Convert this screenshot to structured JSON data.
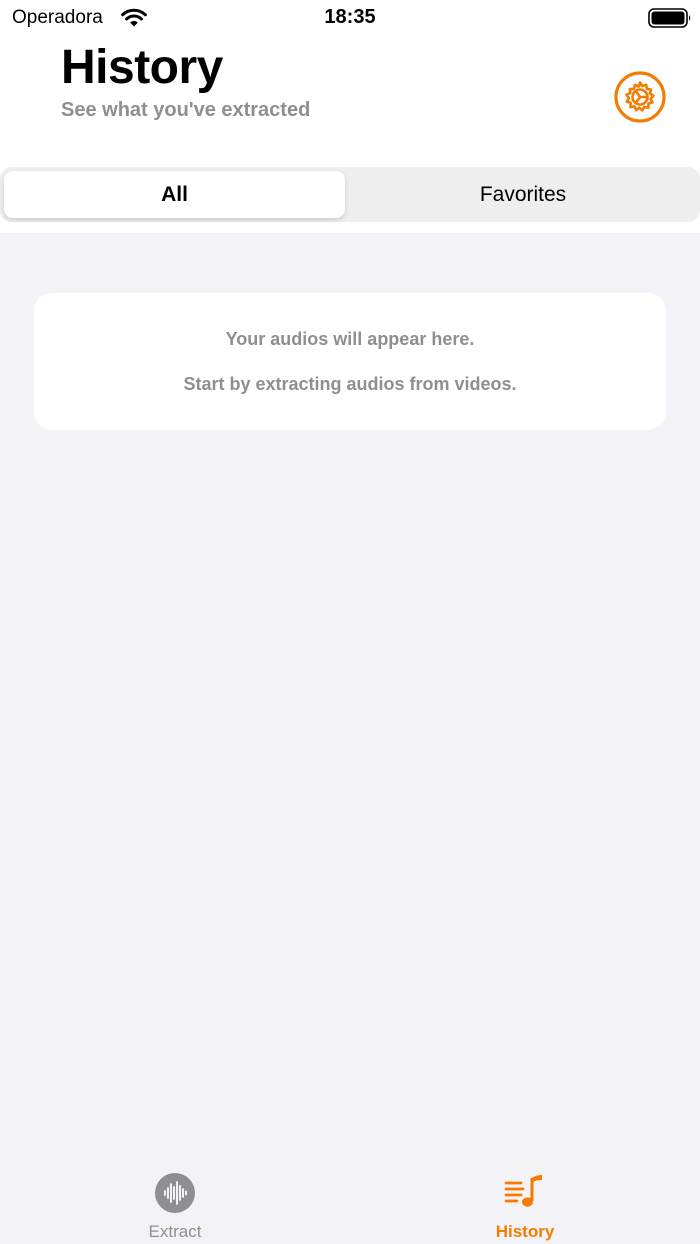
{
  "status_bar": {
    "carrier": "Operadora",
    "time": "18:35"
  },
  "header": {
    "title": "History",
    "subtitle": "See what you've extracted",
    "settings_icon": "settings-gear-icon"
  },
  "segments": {
    "items": [
      {
        "label": "All",
        "selected": true
      },
      {
        "label": "Favorites",
        "selected": false
      }
    ]
  },
  "empty_state": {
    "line1": "Your audios will appear here.",
    "line2": "Start by extracting audios from videos."
  },
  "tabbar": {
    "items": [
      {
        "label": "Extract",
        "icon": "waveform-icon",
        "active": false
      },
      {
        "label": "History",
        "icon": "music-list-icon",
        "active": true
      }
    ]
  },
  "colors": {
    "accent": "#F57C00",
    "secondary_text": "#8E8E93",
    "background": "#F2F2F7"
  }
}
